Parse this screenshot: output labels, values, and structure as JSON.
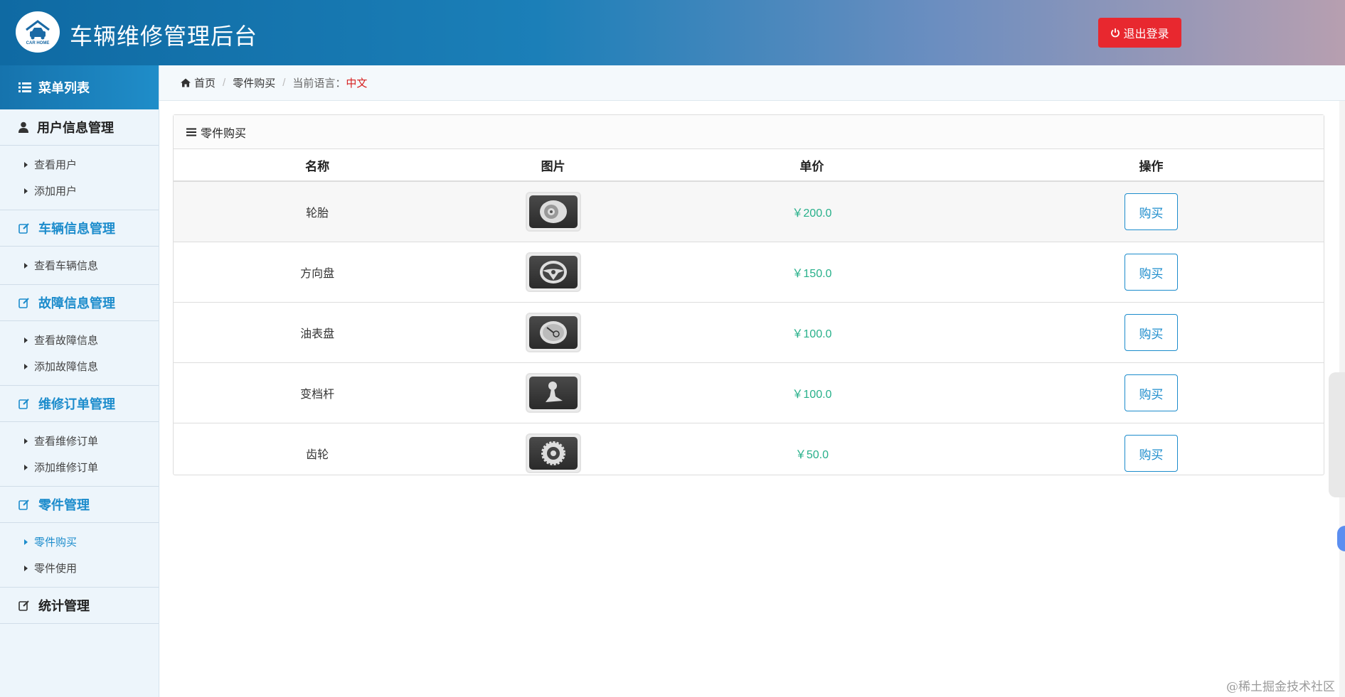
{
  "header": {
    "logo_text": "CAR HOME",
    "title": "车辆维修管理后台",
    "logout_label": "退出登录"
  },
  "sidebar": {
    "menu_title": "菜单列表",
    "groups": [
      {
        "title": "用户信息管理",
        "icon": "user-icon",
        "items": [
          "查看用户",
          "添加用户"
        ]
      },
      {
        "title": "车辆信息管理",
        "icon": "edit-icon",
        "items": [
          "查看车辆信息"
        ]
      },
      {
        "title": "故障信息管理",
        "icon": "edit-icon",
        "items": [
          "查看故障信息",
          "添加故障信息"
        ]
      },
      {
        "title": "维修订单管理",
        "icon": "edit-icon",
        "items": [
          "查看维修订单",
          "添加维修订单"
        ]
      },
      {
        "title": "零件管理",
        "icon": "edit-icon",
        "items": [
          "零件购买",
          "零件使用"
        ],
        "active_item": "零件购买"
      },
      {
        "title": "统计管理",
        "icon": "edit-icon",
        "items": []
      }
    ]
  },
  "breadcrumb": {
    "home": "首页",
    "current": "零件购买",
    "lang_label": "当前语言：",
    "lang_value": "中文"
  },
  "panel": {
    "title": "零件购买",
    "columns": [
      "名称",
      "图片",
      "单价",
      "操作"
    ],
    "rows": [
      {
        "name": "轮胎",
        "image": "tire-icon",
        "price": "￥200.0",
        "action": "购买"
      },
      {
        "name": "方向盘",
        "image": "steering-wheel-icon",
        "price": "￥150.0",
        "action": "购买"
      },
      {
        "name": "油表盘",
        "image": "fuel-gauge-icon",
        "price": "￥100.0",
        "action": "购买"
      },
      {
        "name": "变档杆",
        "image": "gear-shift-icon",
        "price": "￥100.0",
        "action": "购买"
      },
      {
        "name": "齿轮",
        "image": "gear-icon",
        "price": "￥50.0",
        "action": "购买"
      }
    ]
  },
  "watermark": "@稀土掘金技术社区",
  "colors": {
    "accent": "#1c8ccc",
    "price": "#27b08a",
    "danger": "#e8282f",
    "lang": "#d62020"
  }
}
